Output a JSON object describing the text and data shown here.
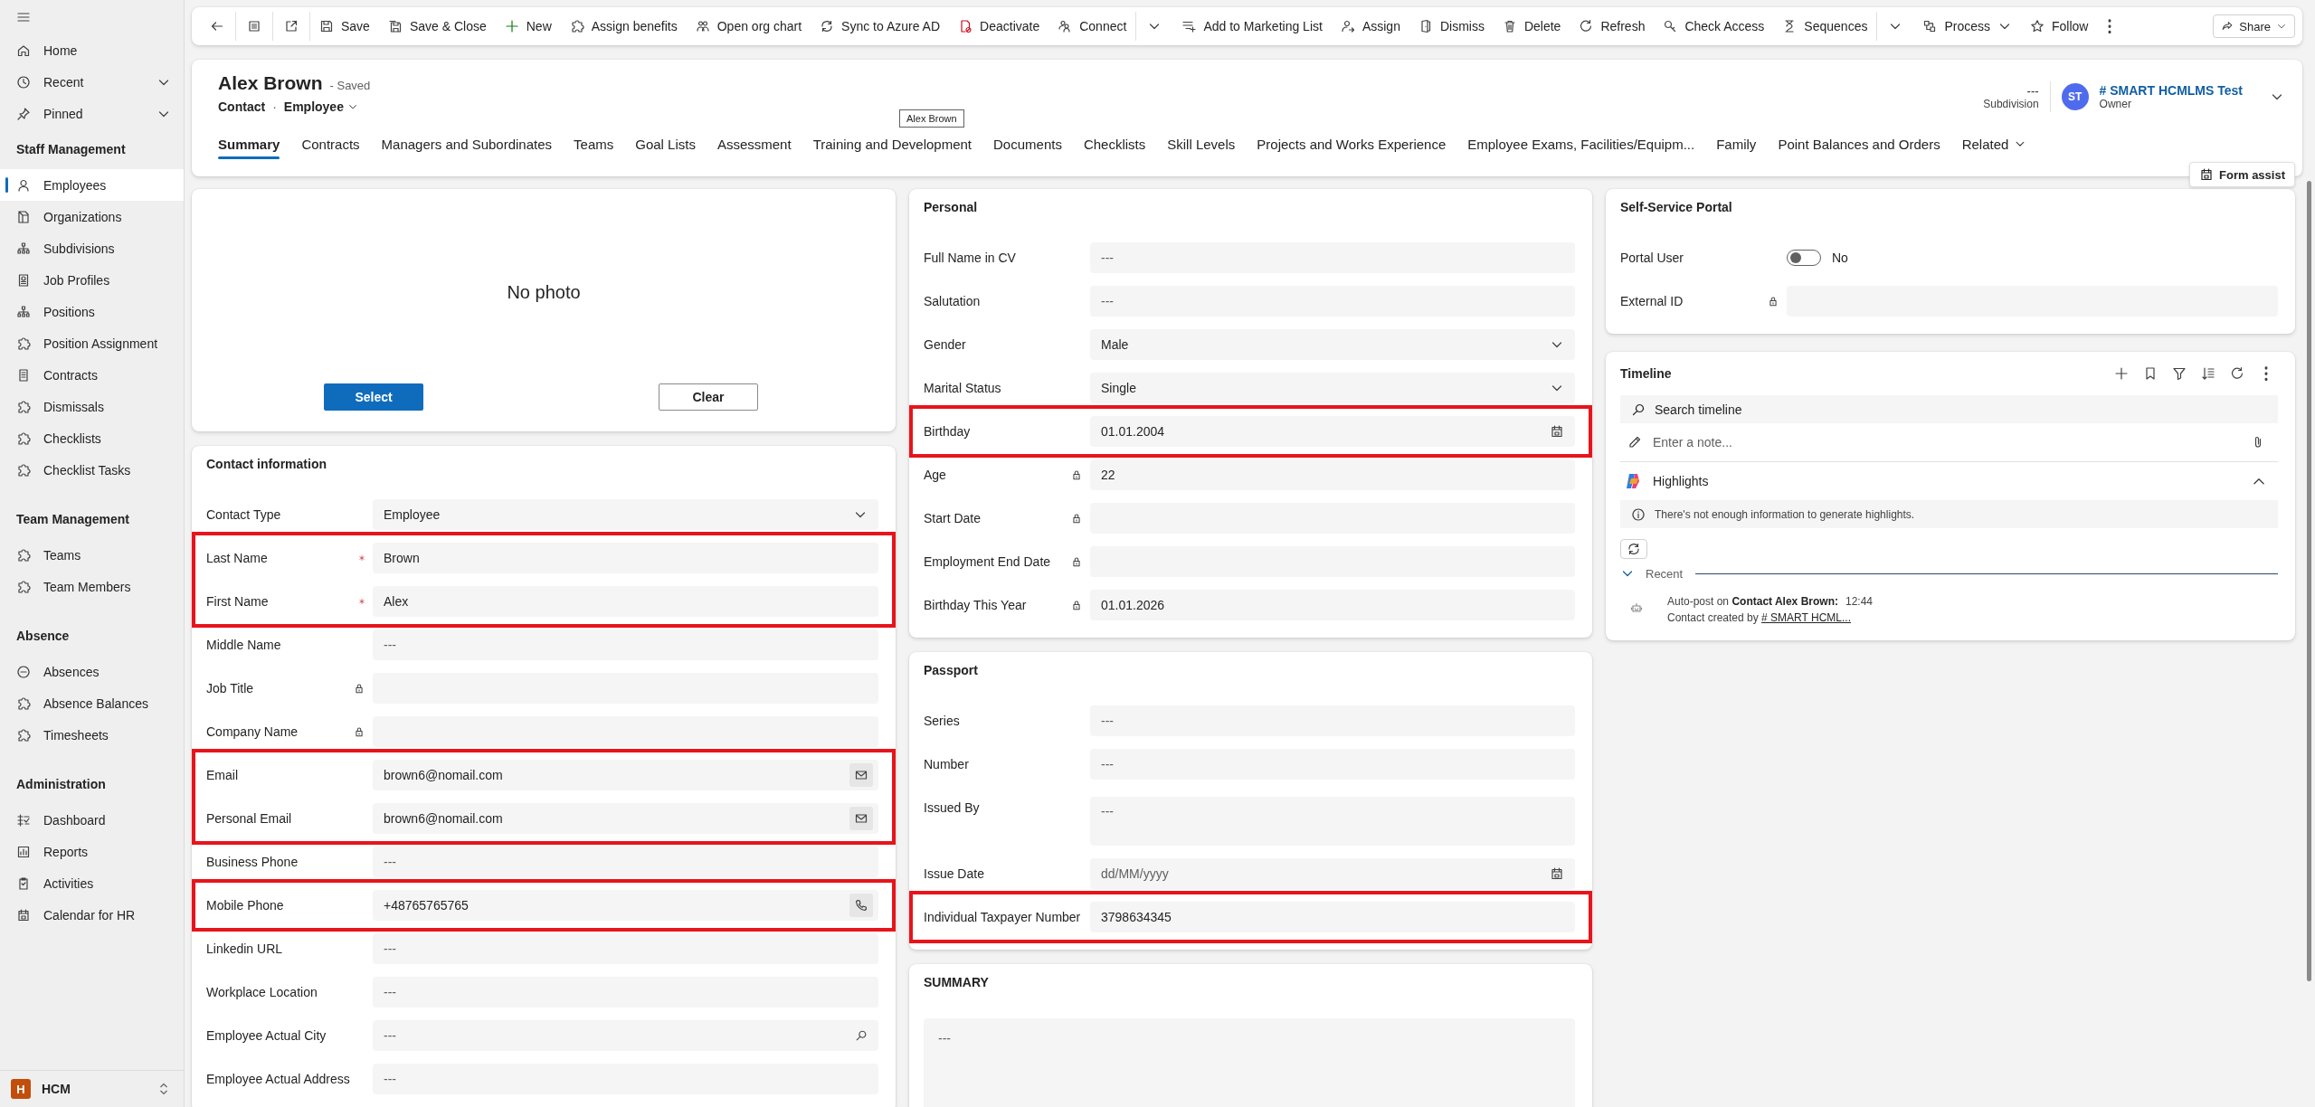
{
  "sidebar": {
    "top_items": [
      {
        "label": "Home",
        "kind": "link"
      },
      {
        "label": "Recent",
        "kind": "menu"
      },
      {
        "label": "Pinned",
        "kind": "menu"
      }
    ],
    "groups": [
      {
        "title": "Staff Management",
        "items": [
          {
            "label": "Employees",
            "selected": true
          },
          {
            "label": "Organizations",
            "selected": false
          },
          {
            "label": "Subdivisions",
            "selected": false
          },
          {
            "label": "Job Profiles",
            "selected": false
          },
          {
            "label": "Positions",
            "selected": false
          },
          {
            "label": "Position Assignment",
            "selected": false
          },
          {
            "label": "Contracts",
            "selected": false
          },
          {
            "label": "Dismissals",
            "selected": false
          },
          {
            "label": "Checklists",
            "selected": false
          },
          {
            "label": "Checklist Tasks",
            "selected": false
          }
        ]
      },
      {
        "title": "Team Management",
        "items": [
          {
            "label": "Teams",
            "selected": false
          },
          {
            "label": "Team Members",
            "selected": false
          }
        ]
      },
      {
        "title": "Absence",
        "items": [
          {
            "label": "Absences",
            "selected": false
          },
          {
            "label": "Absence Balances",
            "selected": false
          },
          {
            "label": "Timesheets",
            "selected": false
          }
        ]
      },
      {
        "title": "Administration",
        "items": [
          {
            "label": "Dashboard",
            "selected": false
          },
          {
            "label": "Reports",
            "selected": false
          },
          {
            "label": "Activities",
            "selected": false
          },
          {
            "label": "Calendar for HR",
            "selected": false
          }
        ]
      }
    ],
    "area": {
      "badge": "H",
      "name": "HCM"
    }
  },
  "toolbar": [
    {
      "kind": "icon"
    },
    {
      "kind": "icon"
    },
    {
      "kind": "icon"
    },
    {
      "kind": "button",
      "label": "Save"
    },
    {
      "kind": "button",
      "label": "Save & Close"
    },
    {
      "kind": "button",
      "label": "New"
    },
    {
      "kind": "button",
      "label": "Assign benefits"
    },
    {
      "kind": "button",
      "label": "Open org chart"
    },
    {
      "kind": "button",
      "label": "Sync to Azure AD"
    },
    {
      "kind": "button",
      "label": "Deactivate"
    },
    {
      "kind": "button",
      "label": "Connect"
    },
    {
      "kind": "chevron"
    },
    {
      "kind": "button",
      "label": "Add to Marketing List"
    },
    {
      "kind": "button",
      "label": "Assign"
    },
    {
      "kind": "button",
      "label": "Dismiss"
    },
    {
      "kind": "button",
      "label": "Delete"
    },
    {
      "kind": "button",
      "label": "Refresh"
    },
    {
      "kind": "button",
      "label": "Check Access"
    },
    {
      "kind": "button",
      "label": "Sequences"
    },
    {
      "kind": "chevron"
    },
    {
      "kind": "menu",
      "label": "Process"
    },
    {
      "kind": "button",
      "label": "Follow"
    },
    {
      "kind": "more"
    },
    {
      "kind": "share",
      "label": "Share"
    }
  ],
  "header": {
    "title": "Alex Brown",
    "save_status": "- Saved",
    "entity": "Contact",
    "separator": "·",
    "form": "Employee",
    "tooltip": "Alex Brown",
    "subdivision": {
      "value": "---",
      "label": "Subdivision"
    },
    "owner": {
      "initials": "ST",
      "name": "# SMART HCMLMS Test",
      "label": "Owner"
    },
    "tabs": [
      {
        "label": "Summary",
        "selected": true
      },
      {
        "label": "Contracts",
        "selected": false
      },
      {
        "label": "Managers and Subordinates",
        "selected": false
      },
      {
        "label": "Teams",
        "selected": false
      },
      {
        "label": "Goal Lists",
        "selected": false
      },
      {
        "label": "Assessment",
        "selected": false
      },
      {
        "label": "Training and Development",
        "selected": false
      },
      {
        "label": "Documents",
        "selected": false
      },
      {
        "label": "Checklists",
        "selected": false
      },
      {
        "label": "Skill Levels",
        "selected": false
      },
      {
        "label": "Projects and Works Experience",
        "selected": false
      },
      {
        "label": "Employee Exams, Facilities/Equipm...",
        "selected": false
      },
      {
        "label": "Family",
        "selected": false
      },
      {
        "label": "Point Balances and Orders",
        "selected": false
      },
      {
        "label": "Related",
        "selected": false,
        "kind": "menu"
      }
    ],
    "form_assist": "Form assist"
  },
  "columns": [
    [
      {
        "kind": "photo",
        "message": "No photo",
        "buttons": [
          {
            "label": "Select",
            "primary": true
          },
          {
            "label": "Clear",
            "primary": false
          }
        ]
      },
      {
        "kind": "form",
        "title": "Contact information",
        "fields": [
          {
            "label": "Contact Type",
            "kind": "dropdown",
            "value": "Employee",
            "required": false,
            "locked": false,
            "highlighted": false
          },
          {
            "label": "Last Name",
            "kind": "text",
            "value": "Brown",
            "required": true,
            "locked": false,
            "highlighted": true
          },
          {
            "label": "First Name",
            "kind": "text",
            "value": "Alex",
            "required": true,
            "locked": false,
            "highlighted": true
          },
          {
            "label": "Middle Name",
            "kind": "text",
            "placeholder": "---",
            "required": false,
            "locked": false,
            "highlighted": false
          },
          {
            "label": "Job Title",
            "kind": "text",
            "required": false,
            "locked": true,
            "highlighted": false
          },
          {
            "label": "Company Name",
            "kind": "text",
            "required": false,
            "locked": true,
            "highlighted": false
          },
          {
            "label": "Email",
            "kind": "email",
            "value": "brown6@nomail.com",
            "required": false,
            "locked": false,
            "highlighted": true
          },
          {
            "label": "Personal Email",
            "kind": "email",
            "value": "brown6@nomail.com",
            "required": false,
            "locked": false,
            "highlighted": true
          },
          {
            "label": "Business Phone",
            "kind": "text",
            "placeholder": "---",
            "required": false,
            "locked": false,
            "highlighted": false
          },
          {
            "label": "Mobile Phone",
            "kind": "phone",
            "value": "+48765765765",
            "required": false,
            "locked": false,
            "highlighted": true
          },
          {
            "label": "Linkedin URL",
            "kind": "text",
            "placeholder": "---",
            "required": false,
            "locked": false,
            "highlighted": false
          },
          {
            "label": "Workplace Location",
            "kind": "text",
            "placeholder": "---",
            "required": false,
            "locked": false,
            "highlighted": false
          },
          {
            "label": "Employee Actual City",
            "kind": "lookup",
            "placeholder": "---",
            "required": false,
            "locked": false,
            "highlighted": false
          },
          {
            "label": "Employee Actual Address",
            "kind": "text",
            "placeholder": "---",
            "required": false,
            "locked": false,
            "highlighted": false
          }
        ]
      }
    ],
    [
      {
        "kind": "form",
        "title": "Personal",
        "fields": [
          {
            "label": "Full Name in CV",
            "kind": "text",
            "placeholder": "---",
            "required": false,
            "locked": false,
            "highlighted": false
          },
          {
            "label": "Salutation",
            "kind": "text",
            "placeholder": "---",
            "required": false,
            "locked": false,
            "highlighted": false
          },
          {
            "label": "Gender",
            "kind": "dropdown",
            "value": "Male",
            "required": false,
            "locked": false,
            "highlighted": false
          },
          {
            "label": "Marital Status",
            "kind": "dropdown",
            "value": "Single",
            "required": false,
            "locked": false,
            "highlighted": false
          },
          {
            "label": "Birthday",
            "kind": "date",
            "value": "01.01.2004",
            "required": false,
            "locked": false,
            "highlighted": true
          },
          {
            "label": "Age",
            "kind": "text",
            "value": "22",
            "required": false,
            "locked": true,
            "highlighted": false
          },
          {
            "label": "Start Date",
            "kind": "text",
            "required": false,
            "locked": true,
            "highlighted": false
          },
          {
            "label": "Employment End Date",
            "kind": "text",
            "required": false,
            "locked": true,
            "highlighted": false
          },
          {
            "label": "Birthday This Year",
            "kind": "text",
            "value": "01.01.2026",
            "required": false,
            "locked": true,
            "highlighted": false
          }
        ]
      },
      {
        "kind": "form",
        "title": "Passport",
        "fields": [
          {
            "label": "Series",
            "kind": "text",
            "placeholder": "---",
            "required": false,
            "locked": false,
            "highlighted": false
          },
          {
            "label": "Number",
            "kind": "text",
            "placeholder": "---",
            "required": false,
            "locked": false,
            "highlighted": false
          },
          {
            "label": "Issued By",
            "kind": "multiline",
            "placeholder": "---",
            "required": false,
            "locked": false,
            "highlighted": false
          },
          {
            "label": "Issue Date",
            "kind": "date",
            "placeholder": "dd/MM/yyyy",
            "required": false,
            "locked": false,
            "highlighted": false
          },
          {
            "label": "Individual Taxpayer Number",
            "kind": "text",
            "value": "3798634345",
            "required": false,
            "locked": false,
            "highlighted": true
          }
        ]
      },
      {
        "kind": "textarea",
        "title": "SUMMARY",
        "placeholder": "---"
      }
    ],
    [
      {
        "kind": "form",
        "title": "Self-Service Portal",
        "fields": [
          {
            "label": "Portal User",
            "kind": "toggle",
            "on": false,
            "value": "No",
            "required": false,
            "locked": false,
            "highlighted": false
          },
          {
            "label": "External ID",
            "kind": "text",
            "required": false,
            "locked": true,
            "highlighted": false
          }
        ]
      },
      {
        "kind": "timeline",
        "title": "Timeline",
        "search_placeholder": "Search timeline",
        "note_placeholder": "Enter a note...",
        "highlights": {
          "title": "Highlights",
          "expanded": true,
          "message": "There's not enough information to generate highlights."
        },
        "recent": {
          "label": "Recent",
          "expanded": true,
          "entries": [
            {
              "title": "Auto-post on **Contact Alex Brown:**",
              "time": "12:44",
              "text": "Contact created by",
              "link": "# SMART HCML..."
            }
          ]
        }
      }
    ]
  ]
}
